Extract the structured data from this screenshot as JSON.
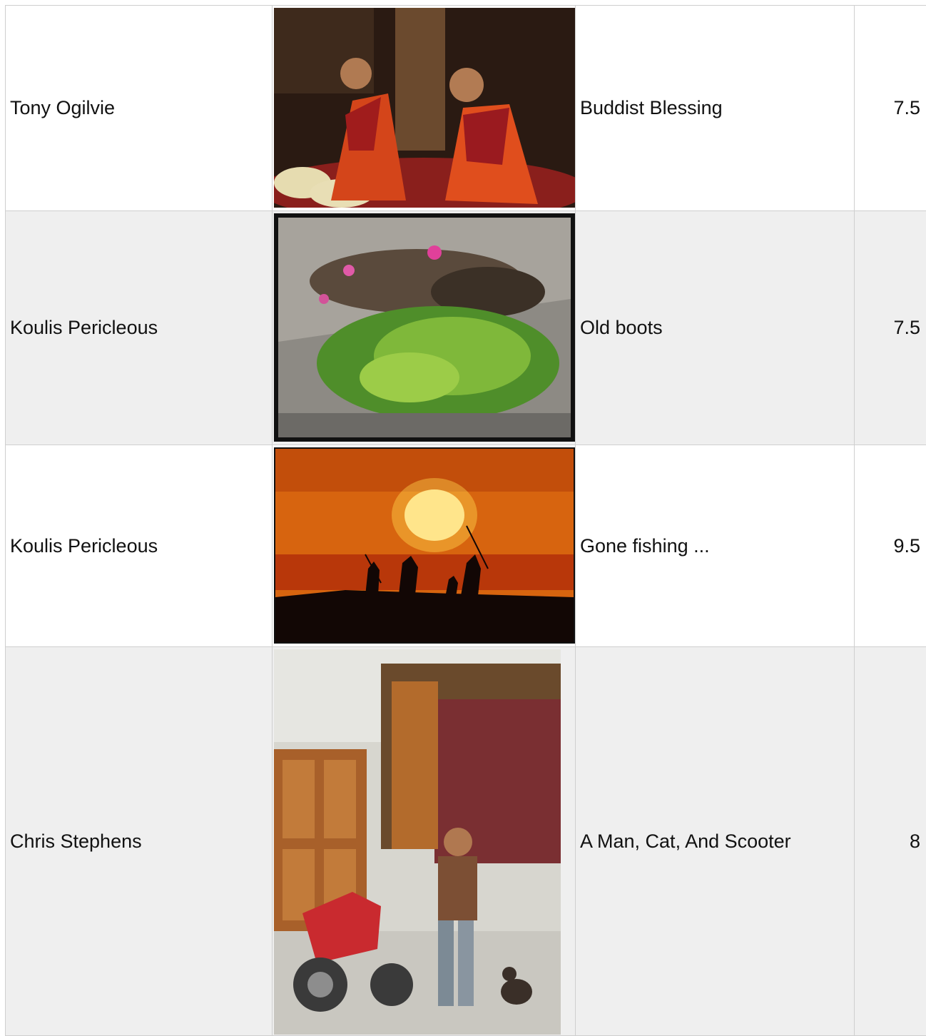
{
  "rows": [
    {
      "author": "Tony Ogilvie",
      "title": "Buddist Blessing",
      "score": "7.5",
      "photo_icon": "monks-photo"
    },
    {
      "author": "Koulis Pericleous",
      "title": "Old boots",
      "score": "7.5",
      "photo_icon": "boots-flowers-photo"
    },
    {
      "author": "Koulis Pericleous",
      "title": "Gone fishing ...",
      "score": "9.5",
      "photo_icon": "sunset-fishermen-photo"
    },
    {
      "author": "Chris Stephens",
      "title": "A Man, Cat, And Scooter",
      "score": "8",
      "photo_icon": "man-cat-scooter-photo"
    }
  ],
  "colors": {
    "border": "#cfcfcf",
    "alt_row": "#efefef"
  }
}
